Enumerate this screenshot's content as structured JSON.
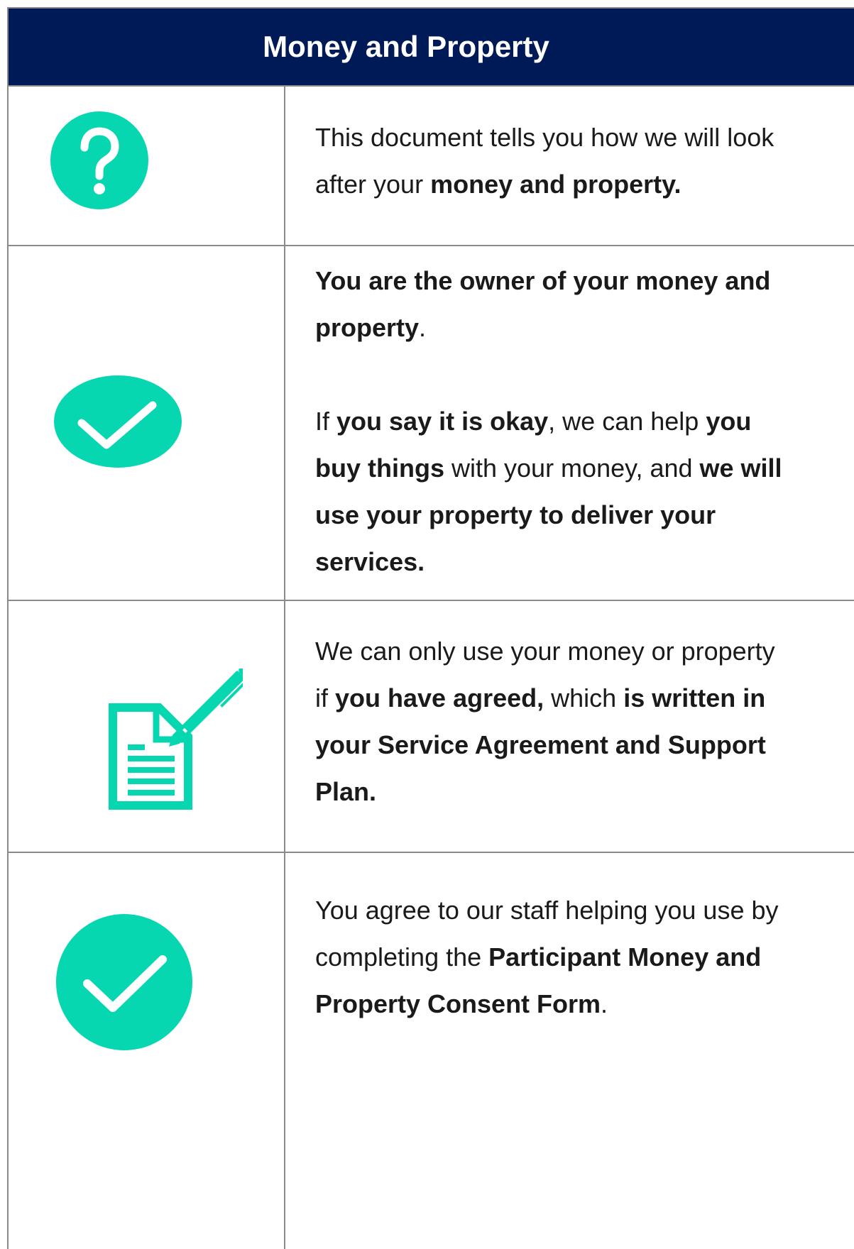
{
  "header": {
    "title": "Money and Property"
  },
  "colors": {
    "header_bg": "#001a57",
    "accent": "#07d7b1",
    "border": "#8a8a8a"
  },
  "rows": [
    {
      "icon": "question-mark-icon",
      "p1_a": "This document tells you how we will look after your ",
      "p1_b": "money and property."
    },
    {
      "icon": "checkmark-icon",
      "p1_a": "You are the owner of your money and property",
      "p1_b": ".",
      "p2_a": "If ",
      "p2_b": "you say it is okay",
      "p2_c": ", we can help ",
      "p2_d": "you buy things",
      "p2_e": " with your money, and ",
      "p2_f": "we will use your property to deliver your services."
    },
    {
      "icon": "signed-document-icon",
      "p1_a": "We can only use your money or property if ",
      "p1_b": "you have agreed,",
      "p1_c": " which ",
      "p1_d": "is written in your Service Agreement and Support Plan."
    },
    {
      "icon": "checkmark-icon",
      "p1_a": "You agree to our staff helping you use by completing the ",
      "p1_b": "Participant Money and Property Consent Form",
      "p1_c": "."
    }
  ]
}
